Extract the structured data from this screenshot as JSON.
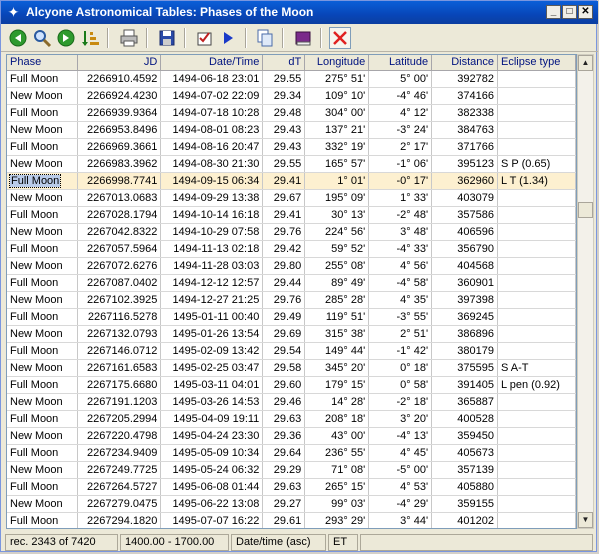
{
  "window": {
    "title": "Alcyone Astronomical Tables: Phases of the Moon"
  },
  "toolbar": {
    "buttons": [
      "back-icon",
      "search-icon",
      "forward-icon",
      "sort-icon",
      "print-icon",
      "save-icon",
      "checklist-icon",
      "play-icon",
      "copy-icon",
      "book-icon",
      "clear-icon"
    ]
  },
  "table": {
    "headers": [
      "Phase",
      "JD",
      "Date/Time",
      "dT",
      "Longitude",
      "Latitude",
      "Distance",
      "Eclipse type"
    ],
    "selected_index": 6,
    "rows": [
      [
        "Full Moon",
        "2266910.4592",
        "1494-06-18",
        "23:01",
        "29.55",
        "275° 51'",
        "5° 00'",
        "392782",
        ""
      ],
      [
        "New Moon",
        "2266924.4230",
        "1494-07-02",
        "22:09",
        "29.34",
        "109° 10'",
        "-4° 46'",
        "374166",
        ""
      ],
      [
        "Full Moon",
        "2266939.9364",
        "1494-07-18",
        "10:28",
        "29.48",
        "304° 00'",
        "4° 12'",
        "382338",
        ""
      ],
      [
        "New Moon",
        "2266953.8496",
        "1494-08-01",
        "08:23",
        "29.43",
        "137° 21'",
        "-3° 24'",
        "384763",
        ""
      ],
      [
        "Full Moon",
        "2266969.3661",
        "1494-08-16",
        "20:47",
        "29.43",
        "332° 19'",
        "2° 17'",
        "371766",
        ""
      ],
      [
        "New Moon",
        "2266983.3962",
        "1494-08-30",
        "21:30",
        "29.55",
        "165° 57'",
        "-1° 06'",
        "395123",
        "S P (0.65)"
      ],
      [
        "Full Moon",
        "2266998.7741",
        "1494-09-15",
        "06:34",
        "29.41",
        "1° 01'",
        "-0° 17'",
        "362960",
        "L T (1.34)"
      ],
      [
        "New Moon",
        "2267013.0683",
        "1494-09-29",
        "13:38",
        "29.67",
        "195° 09'",
        "1° 33'",
        "403079",
        ""
      ],
      [
        "Full Moon",
        "2267028.1794",
        "1494-10-14",
        "16:18",
        "29.41",
        "30° 13'",
        "-2° 48'",
        "357586",
        ""
      ],
      [
        "New Moon",
        "2267042.8322",
        "1494-10-29",
        "07:58",
        "29.76",
        "224° 56'",
        "3° 48'",
        "406596",
        ""
      ],
      [
        "Full Moon",
        "2267057.5964",
        "1494-11-13",
        "02:18",
        "29.42",
        "59° 52'",
        "-4° 33'",
        "356790",
        ""
      ],
      [
        "New Moon",
        "2267072.6276",
        "1494-11-28",
        "03:03",
        "29.80",
        "255° 08'",
        "4° 56'",
        "404568",
        ""
      ],
      [
        "Full Moon",
        "2267087.0402",
        "1494-12-12",
        "12:57",
        "29.44",
        "89° 49'",
        "-4° 58'",
        "360901",
        ""
      ],
      [
        "New Moon",
        "2267102.3925",
        "1494-12-27",
        "21:25",
        "29.76",
        "285° 28'",
        "4° 35'",
        "397398",
        ""
      ],
      [
        "Full Moon",
        "2267116.5278",
        "1495-01-11",
        "00:40",
        "29.49",
        "119° 51'",
        "-3° 55'",
        "369245",
        ""
      ],
      [
        "New Moon",
        "2267132.0793",
        "1495-01-26",
        "13:54",
        "29.69",
        "315° 38'",
        "2° 51'",
        "386896",
        ""
      ],
      [
        "Full Moon",
        "2267146.0712",
        "1495-02-09",
        "13:42",
        "29.54",
        "149° 44'",
        "-1° 42'",
        "380179",
        ""
      ],
      [
        "New Moon",
        "2267161.6583",
        "1495-02-25",
        "03:47",
        "29.58",
        "345° 20'",
        "0° 18'",
        "375595",
        "S A-T"
      ],
      [
        "Full Moon",
        "2267175.6680",
        "1495-03-11",
        "04:01",
        "29.60",
        "179° 15'",
        "0° 58'",
        "391405",
        "L pen (0.92)"
      ],
      [
        "New Moon",
        "2267191.1203",
        "1495-03-26",
        "14:53",
        "29.46",
        "14° 28'",
        "-2° 18'",
        "365887",
        ""
      ],
      [
        "Full Moon",
        "2267205.2994",
        "1495-04-09",
        "19:11",
        "29.63",
        "208° 18'",
        "3° 20'",
        "400528",
        ""
      ],
      [
        "New Moon",
        "2267220.4798",
        "1495-04-24",
        "23:30",
        "29.36",
        "43° 00'",
        "-4° 13'",
        "359450",
        ""
      ],
      [
        "Full Moon",
        "2267234.9409",
        "1495-05-09",
        "10:34",
        "29.64",
        "236° 55'",
        "4° 45'",
        "405673",
        ""
      ],
      [
        "New Moon",
        "2267249.7725",
        "1495-05-24",
        "06:32",
        "29.29",
        "71° 08'",
        "-5° 00'",
        "357139",
        ""
      ],
      [
        "Full Moon",
        "2267264.5727",
        "1495-06-08",
        "01:44",
        "29.63",
        "265° 15'",
        "4° 53'",
        "405880",
        ""
      ],
      [
        "New Moon",
        "2267279.0475",
        "1495-06-22",
        "13:08",
        "29.27",
        "99° 03'",
        "-4° 29'",
        "359155",
        ""
      ],
      [
        "Full Moon",
        "2267294.1820",
        "1495-07-07",
        "16:22",
        "29.61",
        "293° 29'",
        "3° 44'",
        "401202",
        ""
      ]
    ]
  },
  "status": {
    "record": "rec. 2343 of 7420",
    "range": "1400.00 - 1700.00",
    "sort": "Date/time (asc)",
    "timescale": "ET"
  }
}
